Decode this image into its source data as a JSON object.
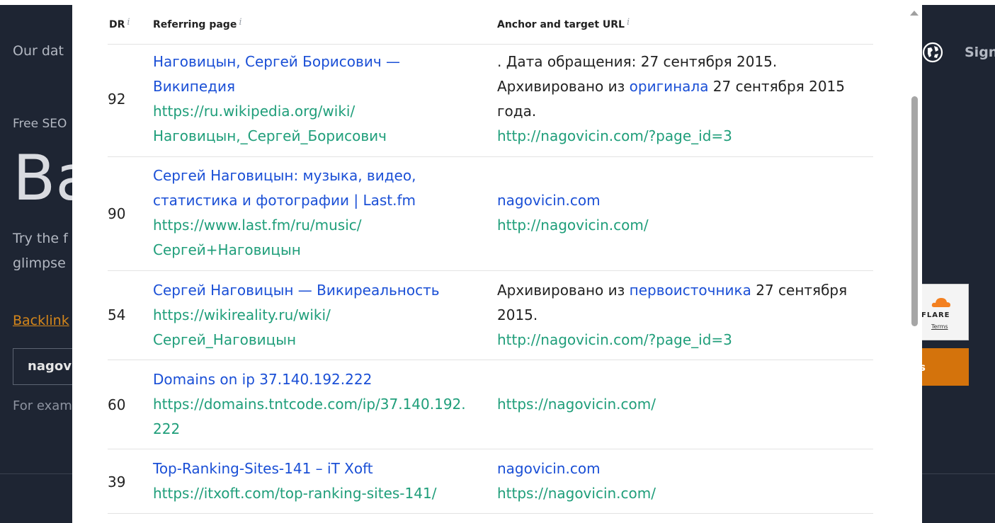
{
  "background": {
    "nav_item": "Our dat",
    "sign_link": "Sign",
    "eyebrow": "Free SEO",
    "heading_partial": "Ba",
    "desc_line1": "Try the f",
    "desc_line2": "glimpse",
    "backlinks_link": "Backlink",
    "input_value": "nagov",
    "example_text": "For exam",
    "cloudflare_label": "FLARE",
    "cloudflare_terms": "Terms",
    "button_partial": "s"
  },
  "table": {
    "headers": {
      "dr": "DR",
      "referring": "Referring page",
      "anchor": "Anchor and target URL",
      "info_glyph": "i"
    },
    "rows": [
      {
        "dr": "92",
        "title_line1": "Наговицын, Сергей Борисович —",
        "title_line2": "Википедия",
        "url_line1": "https://ru.wikipedia.org/wiki/",
        "url_line2": "Наговицын,_Сергей_Борисович",
        "anchor_line1": ". Дата обращения: 27 сентября 2015.",
        "anchor_pre": "Архивировано из ",
        "anchor_link": "оригинала",
        "anchor_post": " 27 сентября 2015",
        "anchor_line3": "года.",
        "target_url": "http://nagovicin.com/?page_id=3"
      },
      {
        "dr": "90",
        "title_line1": "Сергей Наговицын: музыка, видео,",
        "title_line2": "статистика и фотографии | Last.fm",
        "url_line1": "https://www.last.fm/ru/music/",
        "url_line2": "Сергей+Наговицын",
        "anchor_text": "nagovicin.com",
        "target_url": "http://nagovicin.com/"
      },
      {
        "dr": "54",
        "title_line1": "Сергей Наговицын — Викиреальность",
        "url_line1": "https://wikireality.ru/wiki/",
        "url_line2": "Сергей_Наговицын",
        "anchor_pre": "Архивировано из ",
        "anchor_link": "первоисточника",
        "anchor_post": " 27 сентября",
        "anchor_line2": "2015.",
        "target_url": "http://nagovicin.com/?page_id=3"
      },
      {
        "dr": "60",
        "title_line1": "Domains on ip 37.140.192.222",
        "url_line1": "https://domains.tntcode.com/ip/37.140.192.",
        "url_line2": "222",
        "target_url": "https://nagovicin.com/"
      },
      {
        "dr": "39",
        "title_line1": "Top-Ranking-Sites-141 – iT Xoft",
        "url_line1": "https://itxoft.com/top-ranking-sites-141/",
        "anchor_text": "nagovicin.com",
        "target_url": "https://nagovicin.com/"
      }
    ]
  },
  "colors": {
    "page_background": "#1e2533",
    "link_blue": "#1a4fd6",
    "url_green": "#1f9e7a",
    "accent_orange": "#d4730c"
  }
}
